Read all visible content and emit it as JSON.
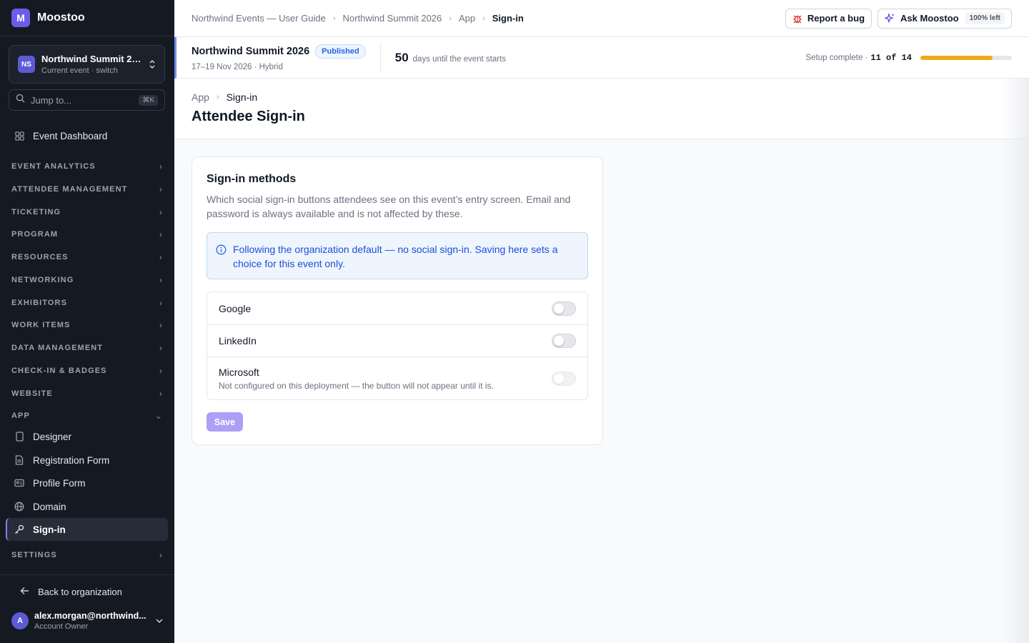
{
  "brand": {
    "logo_letter": "M",
    "name": "Moostoo"
  },
  "event_switcher": {
    "initials": "NS",
    "name": "Northwind Summit 2…",
    "subtitle": "Current event · switch"
  },
  "jump": {
    "placeholder": "Jump to...",
    "shortcut": "⌘K"
  },
  "nav": {
    "dashboard": "Event Dashboard",
    "sections": [
      "EVENT ANALYTICS",
      "ATTENDEE MANAGEMENT",
      "TICKETING",
      "PROGRAM",
      "RESOURCES",
      "NETWORKING",
      "EXHIBITORS",
      "WORK ITEMS",
      "DATA MANAGEMENT",
      "CHECK-IN & BADGES",
      "WEBSITE"
    ],
    "app_section": "APP",
    "app_items": [
      "Designer",
      "Registration Form",
      "Profile Form",
      "Domain",
      "Sign-in"
    ],
    "settings_section": "SETTINGS"
  },
  "sidebar_bottom": {
    "back": "Back to organization",
    "user_initial": "A",
    "user_email": "alex.morgan@northwind...",
    "user_role": "Account Owner"
  },
  "topbar": {
    "breadcrumbs": [
      "Northwind Events — User Guide",
      "Northwind Summit 2026",
      "App",
      "Sign-in"
    ],
    "report_bug": "Report a bug",
    "ask": "Ask Moostoo",
    "ask_quota": "100% left"
  },
  "event_strip": {
    "name": "Northwind Summit 2026",
    "status": "Published",
    "dates": "17–19 Nov 2026 · Hybrid",
    "days_number": "50",
    "days_text": "days until the event starts",
    "setup_label": "Setup complete ·",
    "setup_count": "11 of 14",
    "setup_progress_fraction": 0.786
  },
  "page": {
    "breadcrumbs": [
      "App",
      "Sign-in"
    ],
    "title": "Attendee Sign-in"
  },
  "card": {
    "title": "Sign-in methods",
    "description": "Which social sign-in buttons attendees see on this event’s entry screen. Email and password is always available and is not affected by these.",
    "info": "Following the organization default — no social sign-in. Saving here sets a choice for this event only.",
    "methods": [
      {
        "name": "Google",
        "enabled": false,
        "note": ""
      },
      {
        "name": "LinkedIn",
        "enabled": false,
        "note": ""
      },
      {
        "name": "Microsoft",
        "enabled": false,
        "note": "Not configured on this deployment — the button will not appear until it is."
      }
    ],
    "save_label": "Save"
  },
  "colors": {
    "accent": "#6d5ce8",
    "sidebar_bg": "#151922",
    "progress": "#f0a91b",
    "info_blue": "#1d4ed8"
  }
}
